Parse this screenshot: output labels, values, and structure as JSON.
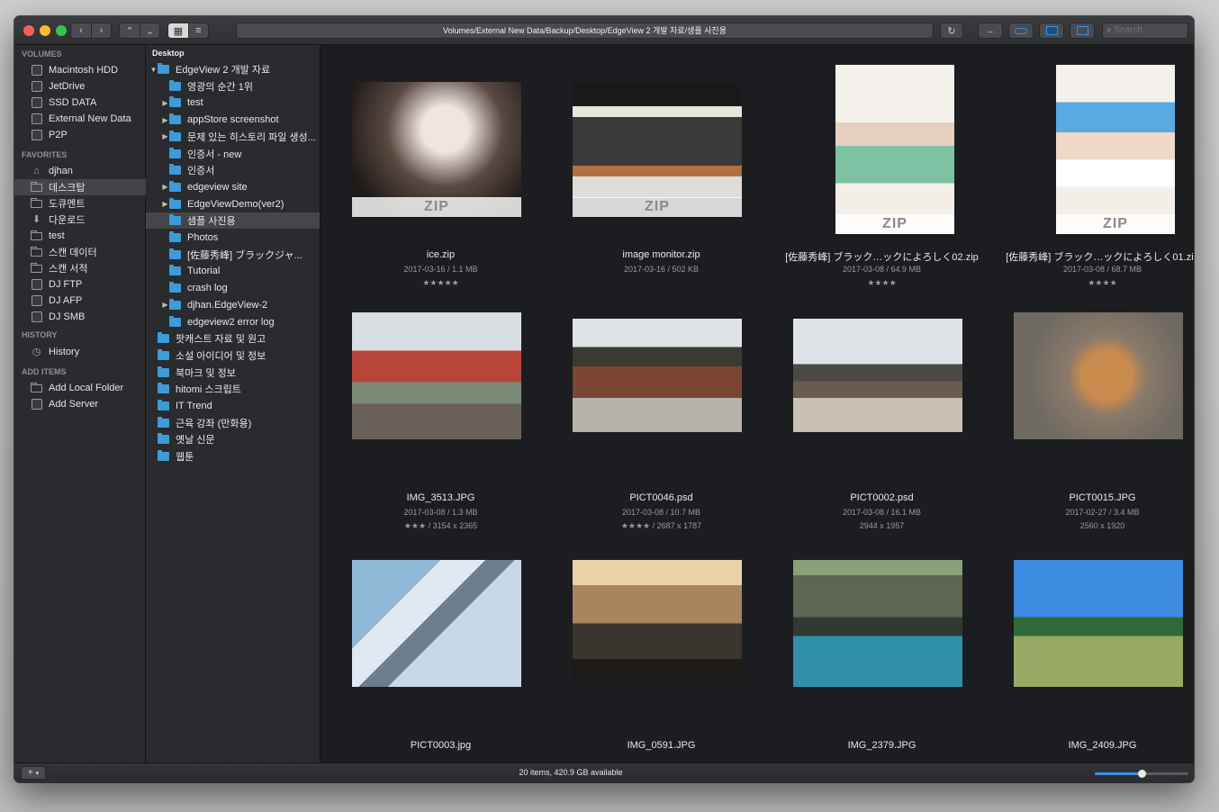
{
  "path": "Volumes/External New Data/Backup/Desktop/EdgeView 2 개발 자료/샘플 사진용",
  "search_placeholder": "Search",
  "sidebar": {
    "volumes_title": "VOLUMES",
    "volumes": [
      "Macintosh HDD",
      "JetDrive",
      "SSD DATA",
      "External New Data",
      "P2P"
    ],
    "favorites_title": "FAVORITES",
    "favorites": [
      "djhan",
      "데스크탑",
      "도큐멘트",
      "다운로드",
      "test",
      "스캔 데이터",
      "스캔 서적",
      "DJ FTP",
      "DJ AFP",
      "DJ SMB"
    ],
    "history_title": "HISTORY",
    "history": [
      "History"
    ],
    "add_title": "ADD ITEMS",
    "add_items": [
      "Add Local Folder",
      "Add Server"
    ]
  },
  "tree": {
    "header": "Desktop",
    "rows": [
      {
        "label": "EdgeView 2 개발 자료",
        "indent": 0,
        "disc": "▼"
      },
      {
        "label": "영광의 순간 1위",
        "indent": 1,
        "disc": ""
      },
      {
        "label": "test",
        "indent": 1,
        "disc": "▶"
      },
      {
        "label": "appStore screenshot",
        "indent": 1,
        "disc": "▶"
      },
      {
        "label": "문제 있는 히스토리 파일 생성...",
        "indent": 1,
        "disc": "▶"
      },
      {
        "label": "인증서 - new",
        "indent": 1,
        "disc": ""
      },
      {
        "label": "인증서",
        "indent": 1,
        "disc": ""
      },
      {
        "label": "edgeview site",
        "indent": 1,
        "disc": "▶"
      },
      {
        "label": "EdgeViewDemo(ver2)",
        "indent": 1,
        "disc": "▶"
      },
      {
        "label": "샘플 사진용",
        "indent": 1,
        "disc": ""
      },
      {
        "label": "Photos",
        "indent": 1,
        "disc": ""
      },
      {
        "label": "[佐藤秀峰] ブラックジャ...",
        "indent": 1,
        "disc": ""
      },
      {
        "label": "Tutorial",
        "indent": 1,
        "disc": ""
      },
      {
        "label": "crash log",
        "indent": 1,
        "disc": ""
      },
      {
        "label": "djhan.EdgeView-2",
        "indent": 1,
        "disc": "▶"
      },
      {
        "label": "edgeview2 error log",
        "indent": 1,
        "disc": ""
      },
      {
        "label": "팟캐스트 자료 및 원고",
        "indent": 0,
        "disc": ""
      },
      {
        "label": "소설 아이디어 및 정보",
        "indent": 0,
        "disc": ""
      },
      {
        "label": "북마크 및 정보",
        "indent": 0,
        "disc": ""
      },
      {
        "label": "hitomi 스크립트",
        "indent": 0,
        "disc": ""
      },
      {
        "label": "IT Trend",
        "indent": 0,
        "disc": ""
      },
      {
        "label": "근육 강좌 (만화용)",
        "indent": 0,
        "disc": ""
      },
      {
        "label": "옛날 신문",
        "indent": 0,
        "disc": ""
      },
      {
        "label": "웹툰",
        "indent": 0,
        "disc": ""
      }
    ]
  },
  "items": [
    {
      "name": "ice.zip",
      "meta": "2017-03-16 / 1.1 MB",
      "extra": "★★★★★",
      "zip": "ZIP"
    },
    {
      "name": "image monitor.zip",
      "meta": "2017-03-16 / 502 KB",
      "extra": "",
      "zip": "ZIP"
    },
    {
      "name": "[佐藤秀峰] ブラック…ックによろしく02.zip",
      "meta": "2017-03-08 / 64.9 MB",
      "extra": "★★★★",
      "zip": "ZIP"
    },
    {
      "name": "[佐藤秀峰] ブラック…ックによろしく01.zip",
      "meta": "2017-03-08 / 68.7 MB",
      "extra": "★★★★",
      "zip": "ZIP"
    },
    {
      "name": "IMG_3513.JPG",
      "meta": "2017-03-08 / 1.3 MB",
      "extra": "★★★ / 3154 x 2365"
    },
    {
      "name": "PICT0046.psd",
      "meta": "2017-03-08 / 10.7 MB",
      "extra": "★★★★ / 2687 x 1787"
    },
    {
      "name": "PICT0002.psd",
      "meta": "2017-03-08 / 16.1 MB",
      "extra": "2944 x 1957"
    },
    {
      "name": "PICT0015.JPG",
      "meta": "2017-02-27 / 3.4 MB",
      "extra": "2560 x 1920"
    },
    {
      "name": "PICT0003.jpg",
      "meta": "",
      "extra": ""
    },
    {
      "name": "IMG_0591.JPG",
      "meta": "",
      "extra": ""
    },
    {
      "name": "IMG_2379.JPG",
      "meta": "",
      "extra": ""
    },
    {
      "name": "IMG_2409.JPG",
      "meta": "",
      "extra": ""
    }
  ],
  "status": "20 items, 420.9 GB available",
  "thumb_size_level": 0.5
}
